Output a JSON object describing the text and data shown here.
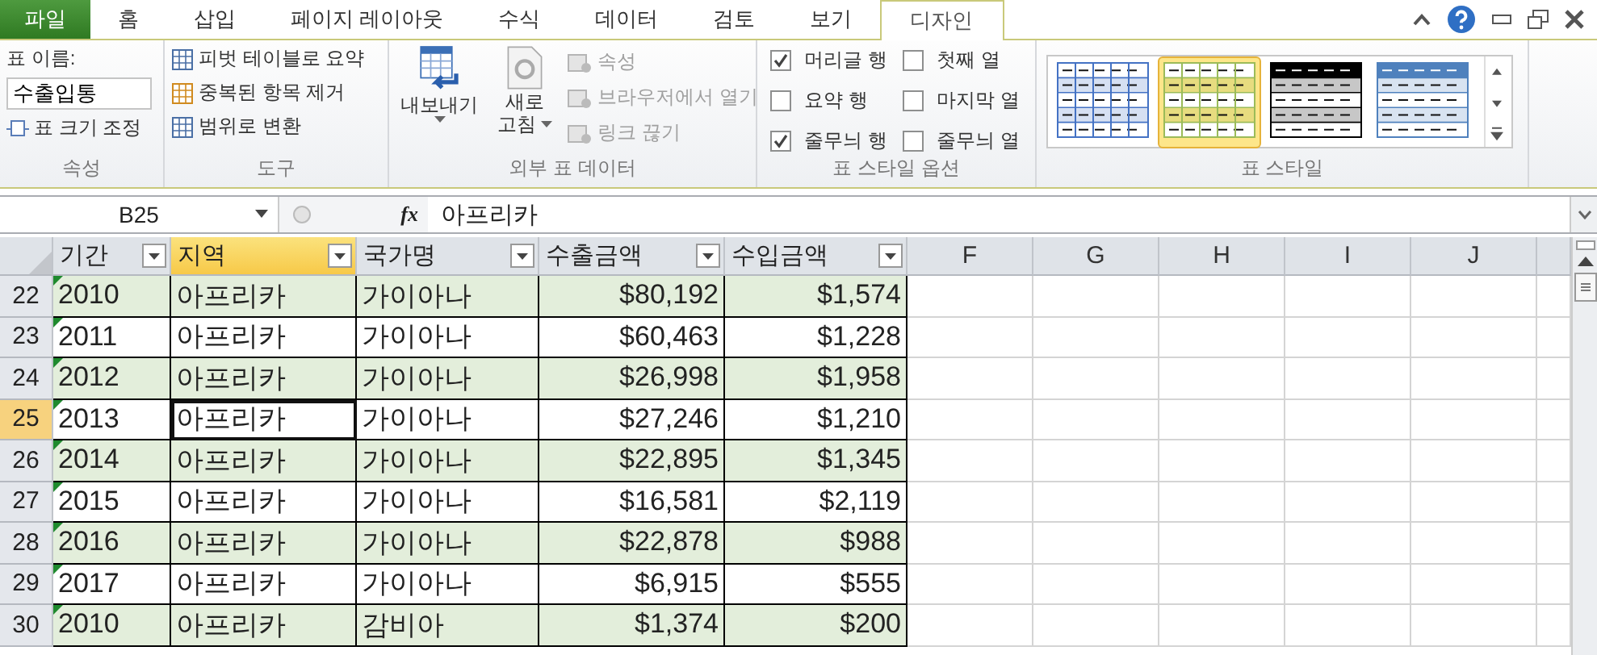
{
  "ribbon": {
    "tabs": [
      {
        "label": "파일",
        "kind": "file",
        "selected": false
      },
      {
        "label": "홈",
        "kind": "normal",
        "selected": false
      },
      {
        "label": "삽입",
        "kind": "normal",
        "selected": false
      },
      {
        "label": "페이지 레이아웃",
        "kind": "normal",
        "selected": false
      },
      {
        "label": "수식",
        "kind": "normal",
        "selected": false
      },
      {
        "label": "데이터",
        "kind": "normal",
        "selected": false
      },
      {
        "label": "검토",
        "kind": "normal",
        "selected": false
      },
      {
        "label": "보기",
        "kind": "normal",
        "selected": false
      },
      {
        "label": "디자인",
        "kind": "contextual",
        "selected": true
      }
    ],
    "properties": {
      "name_label": "표 이름:",
      "name_value": "수출입통",
      "resize": "표 크기 조정",
      "group_label": "속성"
    },
    "tools": {
      "items": [
        "피벗 테이블로 요약",
        "중복된 항목 제거",
        "범위로 변환"
      ],
      "group_label": "도구"
    },
    "external": {
      "export": "내보내기",
      "refresh": [
        "새로",
        "고침"
      ],
      "items": [
        {
          "label": "속성",
          "disabled": true
        },
        {
          "label": "브라우저에서 열기",
          "disabled": true
        },
        {
          "label": "링크 끊기",
          "disabled": true
        }
      ],
      "group_label": "외부 표 데이터"
    },
    "style_options": {
      "options": [
        {
          "label": "머리글 행",
          "checked": true
        },
        {
          "label": "요약 행",
          "checked": false
        },
        {
          "label": "줄무늬 행",
          "checked": true
        },
        {
          "label": "첫째 열",
          "checked": false
        },
        {
          "label": "마지막 열",
          "checked": false
        },
        {
          "label": "줄무늬 열",
          "checked": false
        }
      ],
      "group_label": "표 스타일 옵션"
    },
    "table_styles": {
      "styles": [
        {
          "color": "#4472c4",
          "selected": false
        },
        {
          "color": "#9bbb59",
          "selected": true
        },
        {
          "color": "#000000",
          "selected": false
        },
        {
          "color": "#4f81bd",
          "selected": false
        }
      ],
      "group_label": "표 스타일"
    }
  },
  "formula_bar": {
    "name_box": "B25",
    "fx": "fx",
    "value": "아프리카"
  },
  "sheet": {
    "table_columns": [
      {
        "label": "기간",
        "kind": "text",
        "selected": false,
        "text_number_marks": true
      },
      {
        "label": "지역",
        "kind": "text",
        "selected": true,
        "text_number_marks": false
      },
      {
        "label": "국가명",
        "kind": "text",
        "selected": false,
        "text_number_marks": false
      },
      {
        "label": "수출금액",
        "kind": "currency",
        "selected": false,
        "text_number_marks": false
      },
      {
        "label": "수입금액",
        "kind": "currency",
        "selected": false,
        "text_number_marks": false
      }
    ],
    "letter_columns": [
      "F",
      "G",
      "H",
      "I",
      "J"
    ],
    "rows": [
      {
        "number": "22",
        "selected": false,
        "banded": true,
        "cells": [
          "2010",
          "아프리카",
          "가이아나",
          "$80,192",
          "$1,574"
        ]
      },
      {
        "number": "23",
        "selected": false,
        "banded": false,
        "cells": [
          "2011",
          "아프리카",
          "가이아나",
          "$60,463",
          "$1,228"
        ]
      },
      {
        "number": "24",
        "selected": false,
        "banded": true,
        "cells": [
          "2012",
          "아프리카",
          "가이아나",
          "$26,998",
          "$1,958"
        ]
      },
      {
        "number": "25",
        "selected": true,
        "banded": false,
        "cells": [
          "2013",
          "아프리카",
          "가이아나",
          "$27,246",
          "$1,210"
        ]
      },
      {
        "number": "26",
        "selected": false,
        "banded": true,
        "cells": [
          "2014",
          "아프리카",
          "가이아나",
          "$22,895",
          "$1,345"
        ]
      },
      {
        "number": "27",
        "selected": false,
        "banded": false,
        "cells": [
          "2015",
          "아프리카",
          "가이아나",
          "$16,581",
          "$2,119"
        ]
      },
      {
        "number": "28",
        "selected": false,
        "banded": true,
        "cells": [
          "2016",
          "아프리카",
          "가이아나",
          "$22,878",
          "$988"
        ]
      },
      {
        "number": "29",
        "selected": false,
        "banded": false,
        "cells": [
          "2017",
          "아프리카",
          "가이아나",
          "$6,915",
          "$555"
        ]
      },
      {
        "number": "30",
        "selected": false,
        "banded": true,
        "cells": [
          "2010",
          "아프리카",
          "감비아",
          "$1,374",
          "$200"
        ]
      }
    ]
  }
}
